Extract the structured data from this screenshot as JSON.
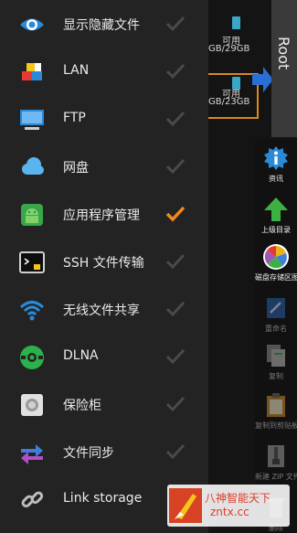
{
  "drawer": {
    "items": [
      {
        "label": "显示隐藏文件",
        "icon": "eye-icon",
        "checked": false
      },
      {
        "label": "LAN",
        "icon": "lan-icon",
        "checked": false
      },
      {
        "label": "FTP",
        "icon": "monitor-icon",
        "checked": false
      },
      {
        "label": "网盘",
        "icon": "cloud-icon",
        "checked": false
      },
      {
        "label": "应用程序管理",
        "icon": "android-icon",
        "checked": true
      },
      {
        "label": "SSH 文件传输",
        "icon": "terminal-icon",
        "checked": false
      },
      {
        "label": "无线文件共享",
        "icon": "wifi-icon",
        "checked": false
      },
      {
        "label": "DLNA",
        "icon": "dlna-icon",
        "checked": false
      },
      {
        "label": "保险柜",
        "icon": "safe-icon",
        "checked": false
      },
      {
        "label": "文件同步",
        "icon": "sync-icon",
        "checked": false
      },
      {
        "label": "Link storage",
        "icon": "link-icon",
        "checked": false
      }
    ]
  },
  "storage": [
    {
      "title": "可用",
      "size": "GB/29GB"
    },
    {
      "title": "可用",
      "size": "GB/23GB"
    }
  ],
  "root_label": "Root",
  "toolbar": [
    {
      "label": "资讯",
      "icon": "info-icon"
    },
    {
      "label": "上级目录",
      "icon": "up-arrow-icon"
    },
    {
      "label": "磁盘存储区图",
      "icon": "pie-chart-icon"
    },
    {
      "label": "重命名",
      "icon": "rename-icon"
    },
    {
      "label": "复制",
      "icon": "copy-icon"
    },
    {
      "label": "复制到剪贴板",
      "icon": "clipboard-icon"
    },
    {
      "label": "新建 ZIP 文件",
      "icon": "zip-icon"
    },
    {
      "label": "删除",
      "icon": "delete-icon"
    }
  ],
  "watermark": {
    "text": "八神智能天下",
    "url": "zntx.cc"
  },
  "colors": {
    "drawer_bg": "#232323",
    "check_active": "#f08a1c",
    "check_inactive": "#4a4a4a",
    "accent_blue": "#2a6fd6"
  }
}
